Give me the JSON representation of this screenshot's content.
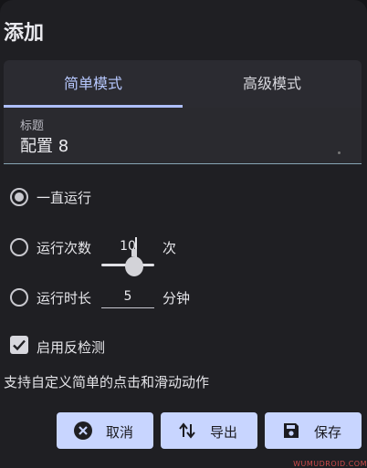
{
  "dialog": {
    "title": "添加"
  },
  "tabs": [
    {
      "label": "简单模式",
      "active": true
    },
    {
      "label": "高级模式",
      "active": false
    }
  ],
  "title_field": {
    "label": "标题",
    "value": "配置 8"
  },
  "run_options": {
    "forever": {
      "label": "一直运行",
      "selected": true
    },
    "count": {
      "label": "运行次数",
      "value": "10",
      "unit": "次",
      "selected": false
    },
    "duration": {
      "label": "运行时长",
      "value": "5",
      "unit": "分钟",
      "selected": false
    }
  },
  "anti_detect": {
    "label": "启用反检测",
    "checked": true
  },
  "description": "支持自定义简单的点击和滑动动作",
  "buttons": {
    "cancel": "取消",
    "export": "导出",
    "save": "保存"
  },
  "watermark": "WUMUDROID.COM",
  "colors": {
    "accent": "#b7c8ff",
    "button_bg": "#c8d5ff",
    "background": "#1f1f23"
  }
}
